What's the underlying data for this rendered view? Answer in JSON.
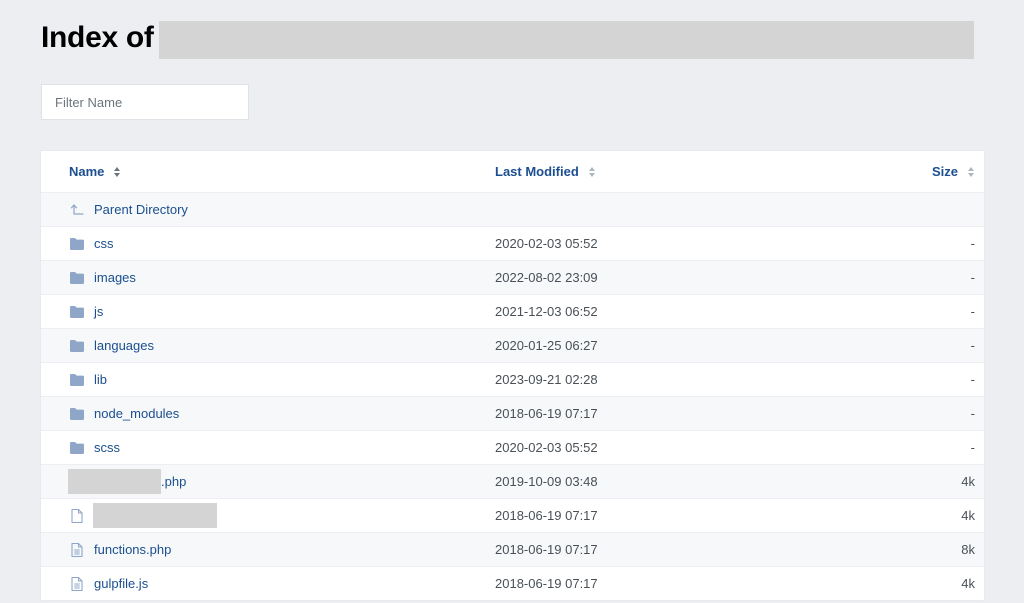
{
  "page": {
    "title_prefix": "Index of"
  },
  "filter": {
    "placeholder": "Filter Name",
    "value": ""
  },
  "table": {
    "columns": {
      "name": "Name",
      "modified": "Last Modified",
      "size": "Size"
    },
    "parent": {
      "label": "Parent Directory",
      "icon": "arrow-up-icon"
    },
    "rows": [
      {
        "name": "css",
        "type": "folder",
        "modified": "2020-02-03 05:52",
        "size": "-"
      },
      {
        "name": "images",
        "type": "folder",
        "modified": "2022-08-02 23:09",
        "size": "-"
      },
      {
        "name": "js",
        "type": "folder",
        "modified": "2021-12-03 06:52",
        "size": "-"
      },
      {
        "name": "languages",
        "type": "folder",
        "modified": "2020-01-25 06:27",
        "size": "-"
      },
      {
        "name": "lib",
        "type": "folder",
        "modified": "2023-09-21 02:28",
        "size": "-"
      },
      {
        "name": "node_modules",
        "type": "folder",
        "modified": "2018-06-19 07:17",
        "size": "-"
      },
      {
        "name": "scss",
        "type": "folder",
        "modified": "2020-02-03 05:52",
        "size": "-"
      },
      {
        "name": ".php",
        "type": "file-text",
        "redacted_prefix": true,
        "modified": "2019-10-09 03:48",
        "size": "4k"
      },
      {
        "name": "",
        "type": "file",
        "redacted_full": true,
        "modified": "2018-06-19 07:17",
        "size": "4k"
      },
      {
        "name": "functions.php",
        "type": "file-text",
        "modified": "2018-06-19 07:17",
        "size": "8k"
      },
      {
        "name": "gulpfile.js",
        "type": "file-text",
        "modified": "2018-06-19 07:17",
        "size": "4k"
      }
    ]
  },
  "colors": {
    "link": "#1b4f8f",
    "icon": "#8fa6c8",
    "background": "#eceef1",
    "redaction": "#d4d4d4"
  }
}
